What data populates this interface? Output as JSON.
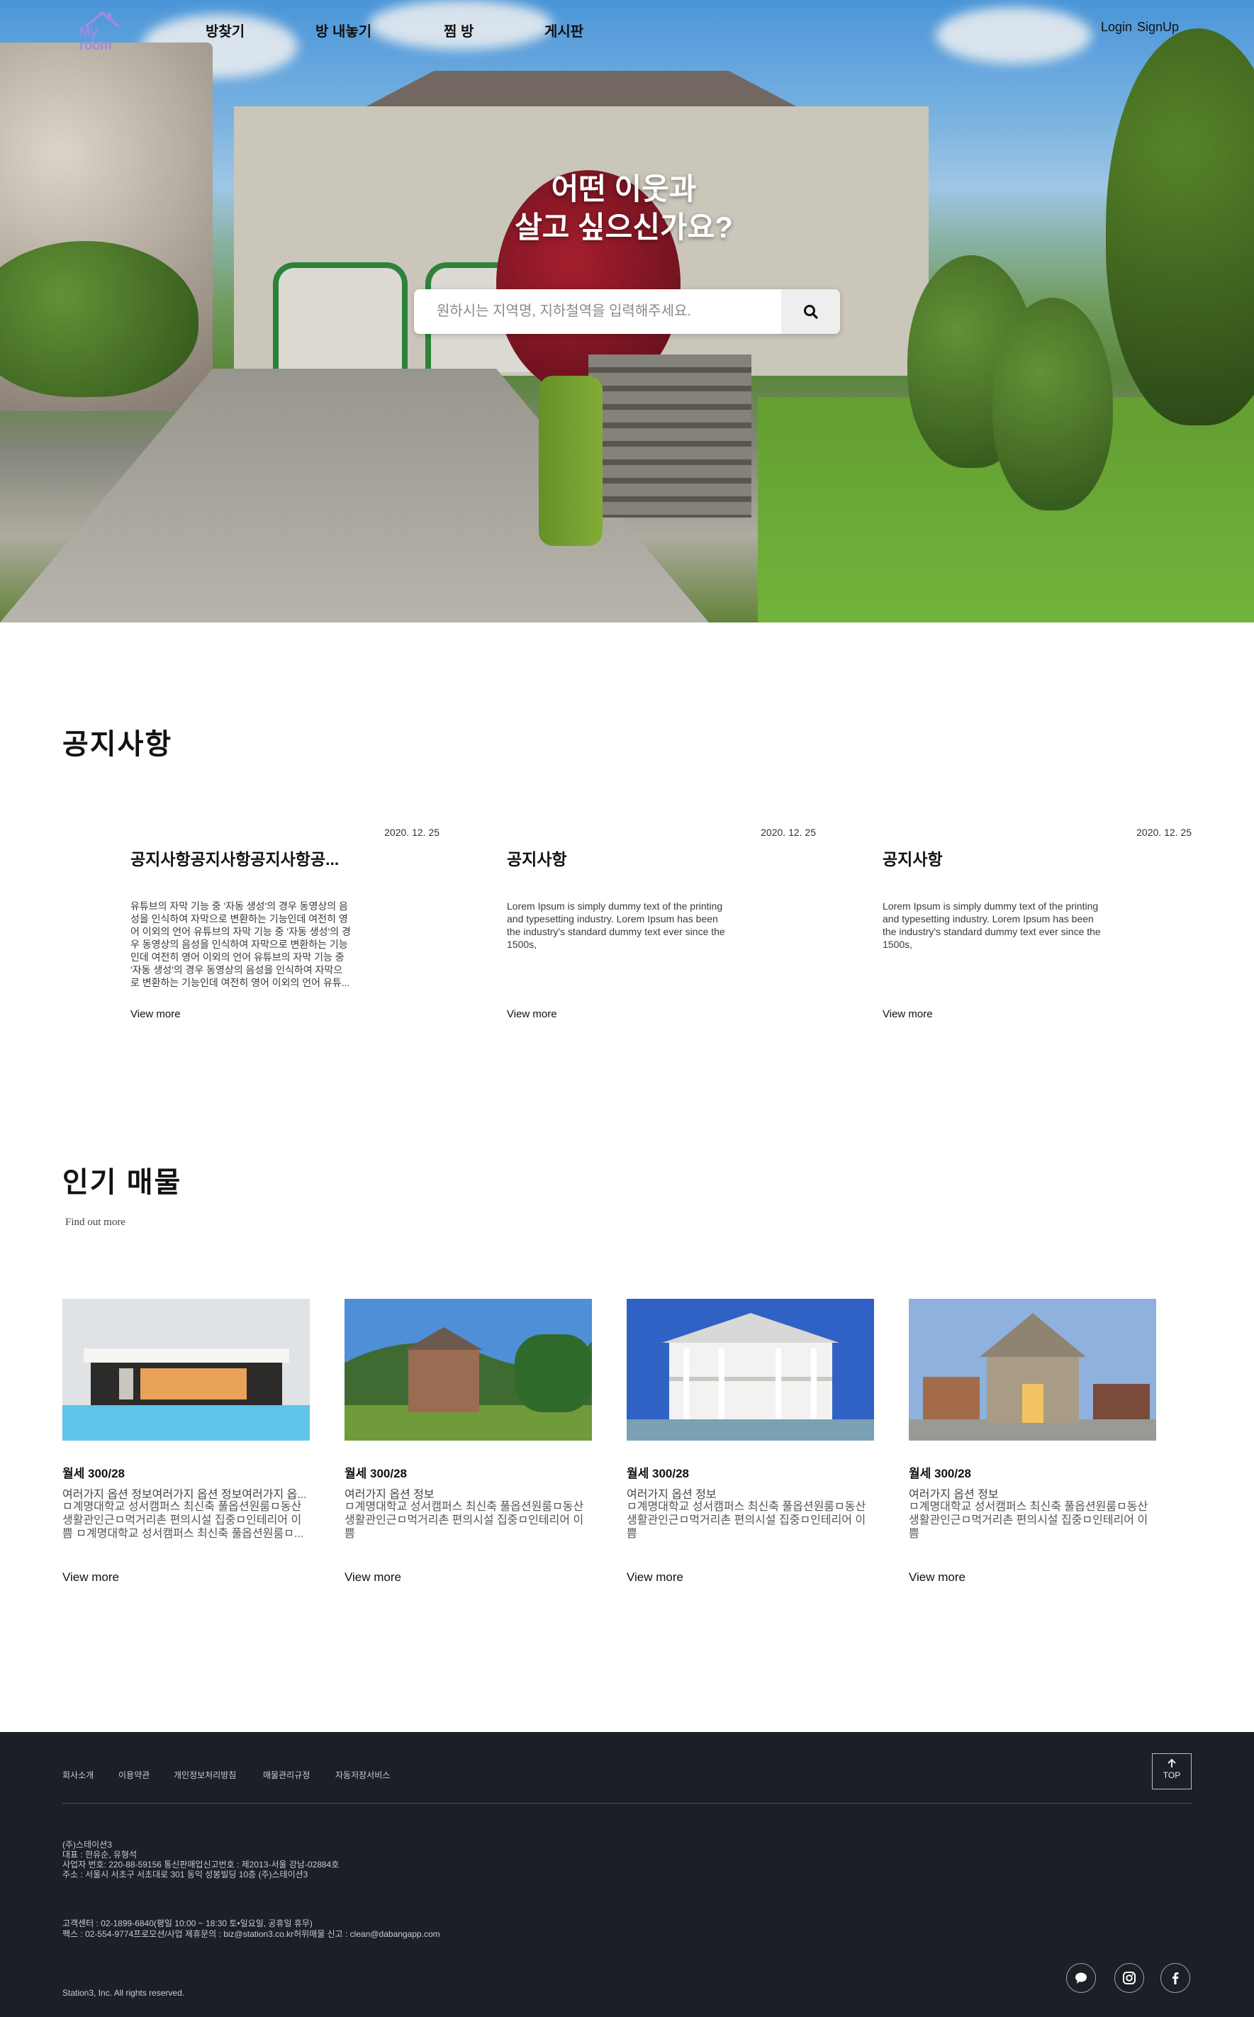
{
  "nav": {
    "logo_text": "My room",
    "items": [
      "방찾기",
      "방 내놓기",
      "찜 방",
      "게시판"
    ],
    "login": "Login",
    "signup": "SignUp"
  },
  "hero": {
    "title_line1": "어떤 이웃과",
    "title_line2": "살고 싶으신가요?",
    "search_placeholder": "원하시는 지역명, 지하철역을 입력해주세요."
  },
  "notice": {
    "title": "공지사항",
    "items": [
      {
        "date": "2020. 12. 25",
        "title": "공지사항공지사항공지사항공...",
        "body": "유튜브의 자막 기능 중 '자동 생성'의 경우 동영상의 음성을 인식하여 자막으로 변환하는 기능인데 여전히 영어 이외의 언어 유튜브의 자막 기능 중 '자동 생성'의 경우 동영상의 음성을 인식하여 자막으로 변환하는 기능인데 여전히 영어 이외의 언어 유튜브의 자막 기능 중 '자동 생성'의 경우 동영상의 음성을 인식하여 자막으로 변환하는 기능인데 여전히 영어 이외의 언어 유튜...",
        "more": "View more"
      },
      {
        "date": "2020. 12. 25",
        "title": "공지사항",
        "body": "Lorem Ipsum is simply dummy text of the printing and typesetting industry. Lorem Ipsum has been the industry's standard dummy text ever since the 1500s,",
        "more": "View more"
      },
      {
        "date": "2020. 12. 25",
        "title": "공지사항",
        "body": "Lorem Ipsum is simply dummy text of the printing and typesetting industry. Lorem Ipsum has been the industry's standard dummy text ever since the 1500s,",
        "more": "View more"
      }
    ]
  },
  "popular": {
    "title": "인기 매물",
    "subtitle": "Find out more",
    "items": [
      {
        "price": "월세 300/28",
        "sub": "여러가지 옵션 정보여러가지 옵션 정보여러가지 옵...",
        "desc": "ㅁ계명대학교 성서캠퍼스 최신축 풀옵션원룸ㅁ동산생활관인근ㅁ먹거리촌 편의시설 집중ㅁ인테리어 이쁨 ㅁ계명대학교 성서캠퍼스 최신축 풀옵션원룸ㅁ...",
        "more": "View more"
      },
      {
        "price": "월세 300/28",
        "sub": "여러가지 옵션 정보",
        "desc": "ㅁ계명대학교 성서캠퍼스 최신축 풀옵션원룸ㅁ동산생활관인근ㅁ먹거리촌 편의시설 집중ㅁ인테리어 이쁨",
        "more": "View more"
      },
      {
        "price": "월세 300/28",
        "sub": "여러가지 옵션 정보",
        "desc": "ㅁ계명대학교 성서캠퍼스 최신축 풀옵션원룸ㅁ동산생활관인근ㅁ먹거리촌 편의시설 집중ㅁ인테리어 이쁨",
        "more": "View more"
      },
      {
        "price": "월세 300/28",
        "sub": "여러가지 옵션 정보",
        "desc": "ㅁ계명대학교 성서캠퍼스 최신축 풀옵션원룸ㅁ동산생활관인근ㅁ먹거리촌 편의시설 집중ㅁ인테리어 이쁨",
        "more": "View more"
      }
    ]
  },
  "footer": {
    "links": [
      "회사소개",
      "이용약관",
      "개인정보처리방침",
      "매물관리규정",
      "자동저장서비스"
    ],
    "top_label": "TOP",
    "company": "(주)스테이션3",
    "ceo": "대표 : 한유순, 유형석",
    "biz_no": "사업자 번호: 220-88-59156 통신판매업신고번호 : 제2013-서울 강남-02884호",
    "address": "주소 : 서울시 서초구 서초대로 301 동익 성봉빌딩 10층 (주)스테이션3",
    "cs": "고객센터 : 02-1899-6840(평일 10:00 ~ 18:30 토•일요일, 공휴일 휴무)",
    "fax": "팩스 : 02-554-9774프로모션/사업 제휴문의 : biz@station3.co.kr허위매물 신고 : clean@dabangapp.com",
    "copyright": "Station3, Inc. All rights reserved.",
    "social_icons": [
      "chat-icon",
      "instagram-icon",
      "facebook-icon"
    ]
  },
  "colors": {
    "footer_bg": "#1c1f26",
    "logo_purple": "#9b8ce0",
    "house_trim_green": "#2f8b3d"
  }
}
